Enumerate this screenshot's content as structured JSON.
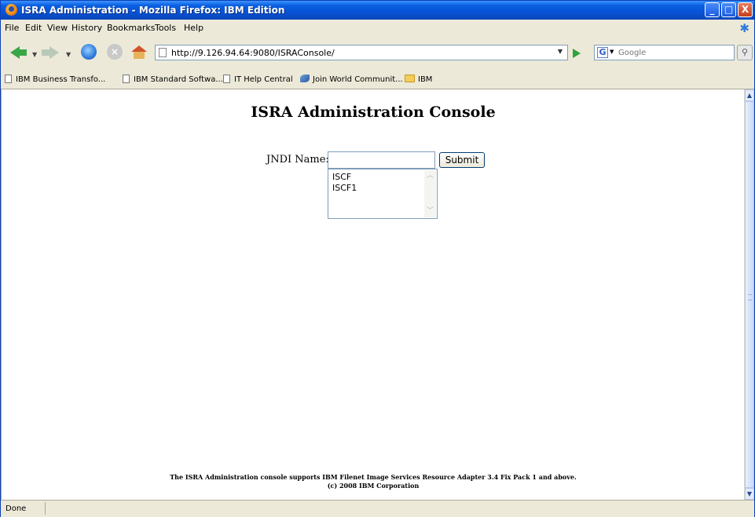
{
  "window": {
    "title": "ISRA Administration - Mozilla Firefox: IBM Edition",
    "controls": {
      "minimize": "_",
      "maximize": "□",
      "close": "X"
    }
  },
  "menubar": {
    "items": [
      "File",
      "Edit",
      "View",
      "History",
      "Bookmarks",
      "Tools",
      "Help"
    ]
  },
  "navbar": {
    "url": "http://9.126.94.64:9080/ISRAConsole/",
    "search_placeholder": "Google"
  },
  "bookmarks": {
    "items": [
      "IBM Business Transfo...",
      "IBM Standard Softwa...",
      "IT Help Central",
      "Join World Communit...",
      "IBM"
    ]
  },
  "page": {
    "title": "ISRA Administration Console",
    "jndi_label": "JNDI Name:",
    "jndi_value": "",
    "submit_label": "Submit",
    "jndi_options": [
      "ISCF",
      "ISCF1"
    ],
    "footer_line1": "The ISRA Administration console supports IBM Filenet Image Services Resource Adapter 3.4 Fix Pack 1 and above.",
    "footer_line2": "(c) 2008 IBM Corporation"
  },
  "status": {
    "text": "Done"
  },
  "colors": {
    "titlebar": "#0753d6",
    "chrome": "#ece9d8",
    "content_bg": "#ffffff"
  }
}
